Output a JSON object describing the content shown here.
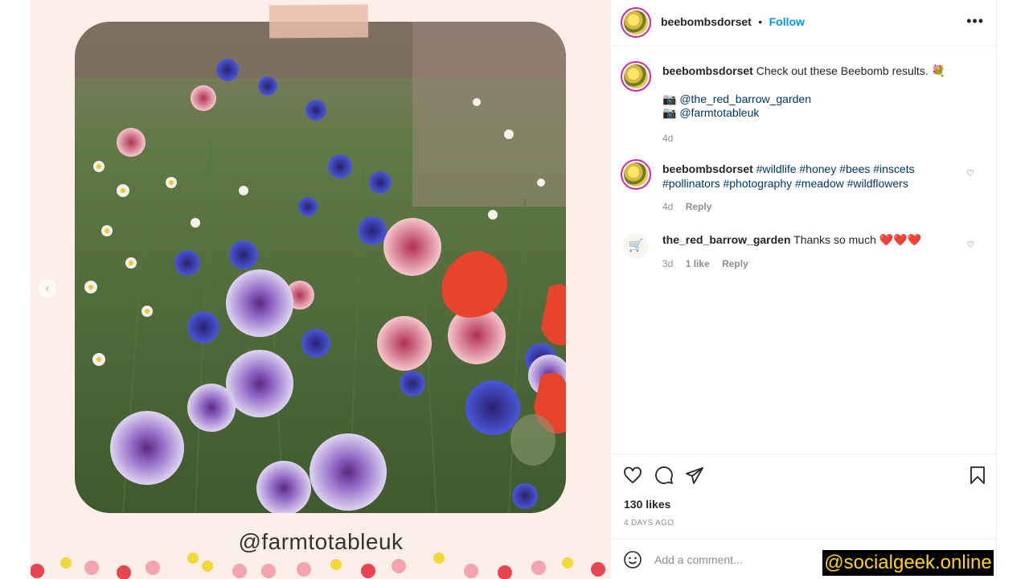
{
  "media": {
    "handle_text": "@farmtotableuk",
    "prev_icon": "chevron-left-icon"
  },
  "header": {
    "username": "beebombsdorset",
    "separator": "•",
    "follow_label": "Follow",
    "more_icon": "more-options-icon"
  },
  "caption": {
    "username": "beebombsdorset",
    "text": "Check out these Beebomb results. 💐",
    "credit_1": "📷 @the_red_barrow_garden",
    "credit_2": "📷 @farmtotableuk",
    "time": "4d"
  },
  "comments": [
    {
      "username": "beebombsdorset",
      "line1": "#wildlife #honey #bees #inscets",
      "line2": "#pollinators #photography #meadow #wildflowers",
      "time": "4d",
      "reply": "Reply"
    },
    {
      "username": "the_red_barrow_garden",
      "text": "Thanks so much ❤️❤️❤️",
      "time": "3d",
      "likes": "1 like",
      "reply": "Reply"
    }
  ],
  "actions": {
    "likes": "130 likes",
    "age": "4 DAYS AGO",
    "add_comment_placeholder": "Add a comment..."
  },
  "watermark": "@socialgeek.online",
  "colors": {
    "follow": "#0095f6",
    "link": "#00376b",
    "meta": "#8e8e8e",
    "media_bg": "#fcefe8",
    "watermark_text": "#ffd21a"
  }
}
